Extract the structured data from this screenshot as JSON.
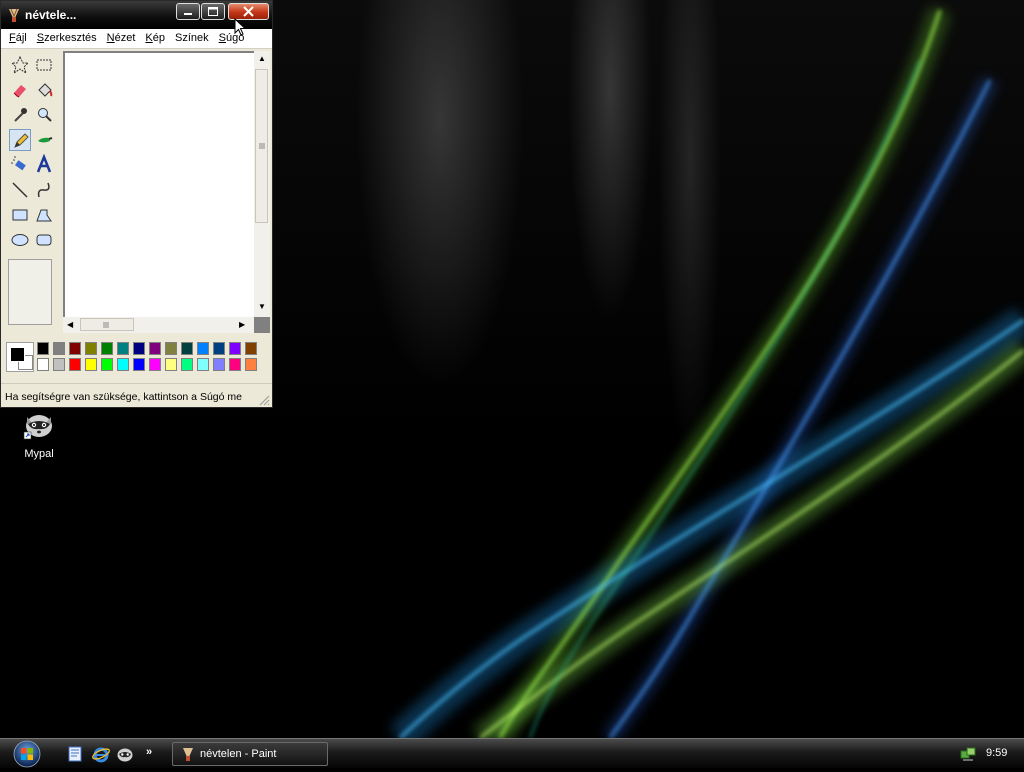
{
  "window": {
    "title": "névtele...",
    "menu": [
      {
        "pre": "",
        "key": "F",
        "post": "ájl"
      },
      {
        "pre": "",
        "key": "S",
        "post": "zerkesztés"
      },
      {
        "pre": "",
        "key": "N",
        "post": "ézet"
      },
      {
        "pre": "",
        "key": "K",
        "post": "ép"
      },
      {
        "pre": "",
        "key": "S",
        "post": "zínek"
      },
      {
        "pre": "",
        "key": "S",
        "post": "úgó"
      }
    ],
    "status_text": "Ha segítségre van szüksége, kattintson a Súgó me"
  },
  "palette": {
    "top_row": [
      "#000000",
      "#808080",
      "#800000",
      "#808000",
      "#008000",
      "#008080",
      "#000080",
      "#800080",
      "#808040",
      "#004040",
      "#0080ff",
      "#004080",
      "#8000ff",
      "#804000"
    ],
    "bottom_row": [
      "#ffffff",
      "#c0c0c0",
      "#ff0000",
      "#ffff00",
      "#00ff00",
      "#00ffff",
      "#0000ff",
      "#ff00ff",
      "#ffff80",
      "#00ff80",
      "#80ffff",
      "#8080ff",
      "#ff0080",
      "#ff8040"
    ]
  },
  "desktop": {
    "icons": [
      {
        "label": "Mypal",
        "icon": "mypal-raccoon-icon"
      }
    ]
  },
  "taskbar": {
    "quick_launch_more": "»",
    "task_button_label": "névtelen - Paint",
    "clock": "9:59"
  }
}
